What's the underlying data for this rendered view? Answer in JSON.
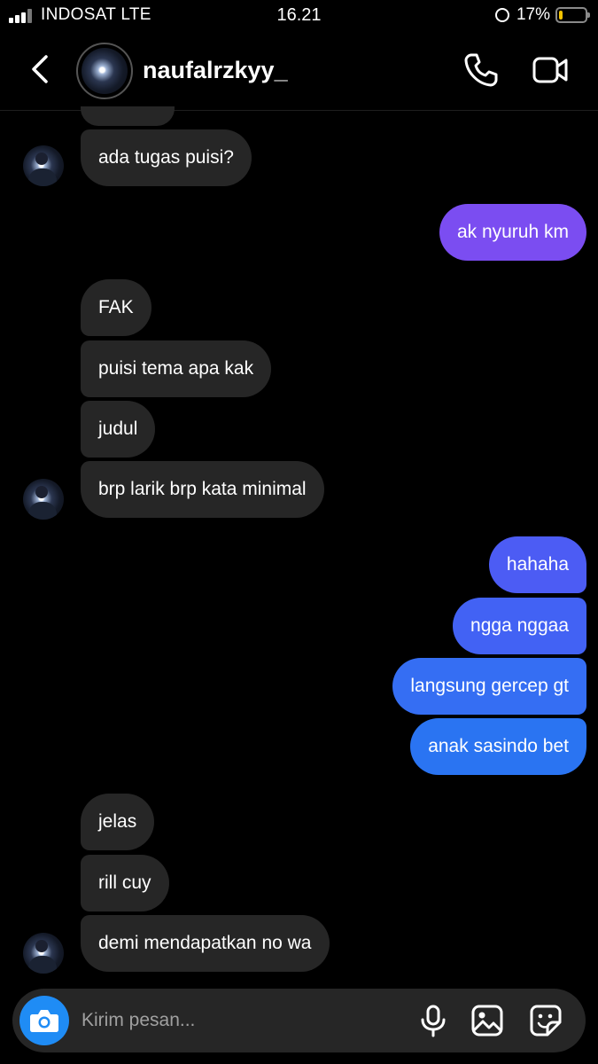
{
  "status_bar": {
    "carrier": "INDOSAT  LTE",
    "time": "16.21",
    "battery": "17%"
  },
  "header": {
    "username": "naufalrzkyy_"
  },
  "messages": [
    {
      "dir": "in",
      "text": "ada tugas puisi?"
    },
    {
      "dir": "out",
      "text": "ak nyuruh km"
    },
    {
      "dir": "in",
      "text": "FAK"
    },
    {
      "dir": "in",
      "text": "puisi tema apa kak"
    },
    {
      "dir": "in",
      "text": "judul"
    },
    {
      "dir": "in",
      "text": "brp larik brp kata minimal"
    },
    {
      "dir": "out",
      "text": "hahaha"
    },
    {
      "dir": "out",
      "text": "ngga nggaa"
    },
    {
      "dir": "out",
      "text": "langsung gercep gt"
    },
    {
      "dir": "out",
      "text": "anak sasindo bet"
    },
    {
      "dir": "in",
      "text": "jelas"
    },
    {
      "dir": "in",
      "text": "rill cuy"
    },
    {
      "dir": "in",
      "text": "demi mendapatkan no wa"
    }
  ],
  "composer": {
    "placeholder": "Kirim pesan..."
  },
  "colors": {
    "incoming": "#262626",
    "outgoing_top": "#6a4ef0",
    "outgoing_bottom": "#2a74f2",
    "camera": "#1f8cf5"
  },
  "icons": [
    "signal-icon",
    "lock-rotation-icon",
    "battery-icon",
    "back-chevron-icon",
    "phone-icon",
    "video-camera-icon",
    "camera-icon",
    "microphone-icon",
    "gallery-icon",
    "sticker-icon"
  ]
}
